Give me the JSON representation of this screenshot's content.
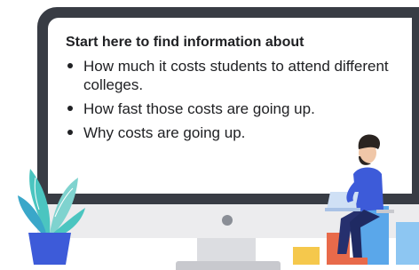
{
  "info_card": {
    "heading": "Start here to find information about",
    "bullets": [
      "How much it costs students to attend different colleges.",
      "How fast those costs are going up.",
      "Why costs are going up."
    ]
  },
  "illustration": {
    "plant_color": "#4bc5c0",
    "pot_color": "#3d5bd9",
    "person_shirt_color": "#3d5bd9",
    "bar_colors": [
      "#f5c84c",
      "#e86a4a",
      "#5aa7ea"
    ]
  }
}
